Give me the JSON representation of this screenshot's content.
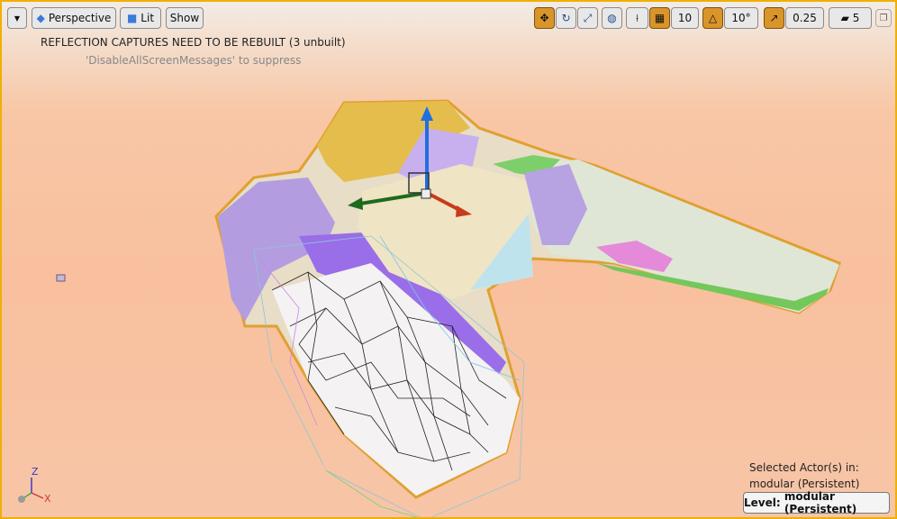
{
  "toolbar": {
    "perspective_label": "Perspective",
    "lit_label": "Lit",
    "show_label": "Show",
    "grid_snap_value": "10",
    "rotation_snap_value": "10°",
    "scale_snap_value": "0.25",
    "camera_speed_value": "5"
  },
  "messages": {
    "reflection_warning": "REFLECTION CAPTURES NEED TO BE REBUILT (3 unbuilt)",
    "suppress_hint": "'DisableAllScreenMessages' to suppress"
  },
  "selection": {
    "line1": "Selected Actor(s) in:",
    "line2": "modular (Persistent)"
  },
  "level": {
    "label": "Level:",
    "value": "modular (Persistent)"
  },
  "axis": {
    "x": "X",
    "z": "Z"
  },
  "colors": {
    "accent": "#d9952a",
    "border": "#f0b000",
    "sky": "#f8c09e"
  }
}
